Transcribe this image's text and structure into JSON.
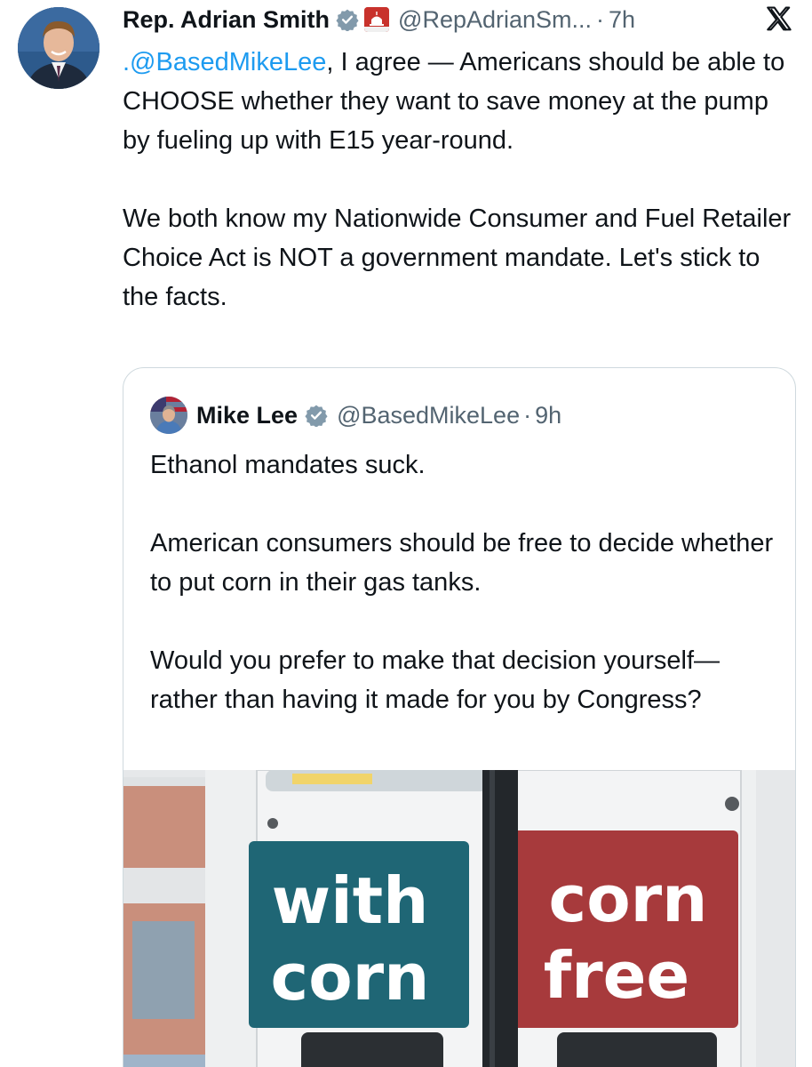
{
  "tweet": {
    "author_name": "Rep. Adrian Smith",
    "handle": "@RepAdrianSm...",
    "separator": "·",
    "time": "7h",
    "mention": ".@BasedMikeLee",
    "line_rest": ", I agree — Americans should be",
    "paragraph1_rest": "able to CHOOSE whether they want to save money at the pump by fueling up with E15 year-round.",
    "paragraph2": "We both know my Nationwide Consumer and Fuel Retailer Choice Act is NOT a government mandate. Let's stick to the facts."
  },
  "quote": {
    "author_name": "Mike Lee",
    "handle": "@BasedMikeLee",
    "separator": "·",
    "time": "9h",
    "paragraph1": "Ethanol mandates suck.",
    "paragraph2": "American consumers should be free to decide whether to put corn in their gas tanks.",
    "paragraph3": "Would you prefer to make that decision yourself—rather than having it made for you by Congress?"
  },
  "image": {
    "left_sign_line1": "with",
    "left_sign_line2": "corn",
    "right_sign_line1": "corn",
    "right_sign_line2": "free"
  },
  "colors": {
    "accent": "#1d9bf0",
    "secondary_text": "#536471",
    "verified_badge": "#829aab",
    "left_sign": "#1f6675",
    "right_sign": "#a73a3c",
    "border": "#cfd9de"
  },
  "icons": {
    "verified": "verified-badge-icon",
    "government": "capitol-badge-icon",
    "x_logo": "x-logo-icon"
  }
}
